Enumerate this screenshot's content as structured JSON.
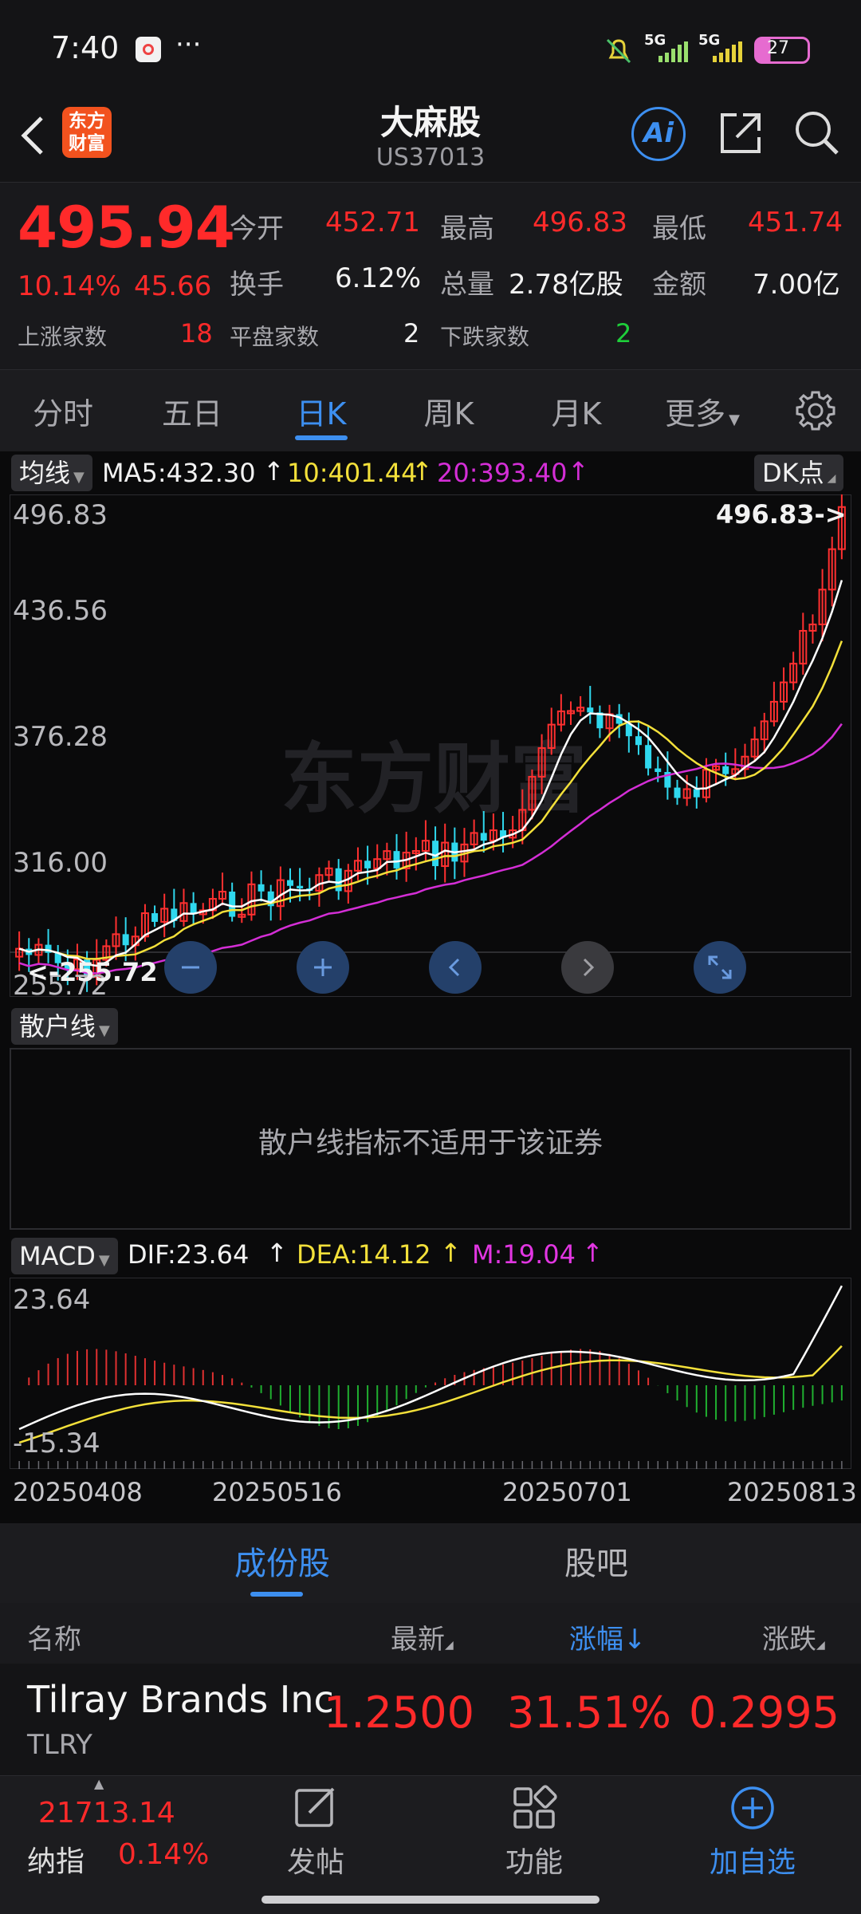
{
  "status_bar": {
    "time": "7:40",
    "dots": "···",
    "signal1": "5G",
    "signal2": "5G",
    "battery": "27"
  },
  "header": {
    "logo_line1": "东方",
    "logo_line2": "财富",
    "title": "大麻股",
    "code": "US37013",
    "ai_label": "Ai"
  },
  "quote": {
    "price": "495.94",
    "change_pct": "10.14%",
    "change": "45.66",
    "open_label": "今开",
    "open": "452.71",
    "high_label": "最高",
    "high": "496.83",
    "low_label": "最低",
    "low": "451.74",
    "turnover_label": "换手",
    "turnover": "6.12%",
    "volume_label": "总量",
    "volume": "2.78亿股",
    "amount_label": "金额",
    "amount": "7.00亿",
    "up_label": "上涨家数",
    "up": "18",
    "flat_label": "平盘家数",
    "flat": "2",
    "down_label": "下跌家数",
    "down": "2"
  },
  "tabs": [
    "分时",
    "五日",
    "日K",
    "周K",
    "月K",
    "更多"
  ],
  "active_tab": "日K",
  "kline": {
    "ma_selector": "均线",
    "ma5": "MA5:432.30",
    "ma10": "10:401.44",
    "ma20": "20:393.40",
    "dk_button": "DK点",
    "y_labels": [
      "496.83",
      "436.56",
      "376.28",
      "316.00",
      "255.72"
    ],
    "max_marker": "496.83->",
    "min_marker": "<-255.72",
    "watermark": "东方财富",
    "colors": {
      "ma5": "#ffffff",
      "ma10": "#f3e03a",
      "ma20": "#d42ed6",
      "up": "#ff3030",
      "down": "#2fd8ee"
    }
  },
  "retail": {
    "selector": "散户线",
    "message": "散户线指标不适用于该证券"
  },
  "macd": {
    "selector": "MACD",
    "dif": "DIF:23.64",
    "dea": "DEA:14.12",
    "m": "M:19.04",
    "y_top": "23.64",
    "y_bottom": "-15.34",
    "dates": [
      "20250408",
      "20250516",
      "20250701",
      "20250813"
    ]
  },
  "bottom_tabs": [
    "成份股",
    "股吧"
  ],
  "table": {
    "col_name": "名称",
    "col_latest": "最新",
    "col_pct": "涨幅",
    "col_change": "涨跌",
    "rows": [
      {
        "name": "Tilray Brands Inc",
        "code": "TLRY",
        "latest": "1.2500",
        "pct": "31.51%",
        "change": "0.2995"
      }
    ]
  },
  "nav": {
    "index_value": "21713.14",
    "index_name": "纳指",
    "index_pct": "0.14%",
    "post": "发帖",
    "func": "功能",
    "add": "加自选"
  }
}
